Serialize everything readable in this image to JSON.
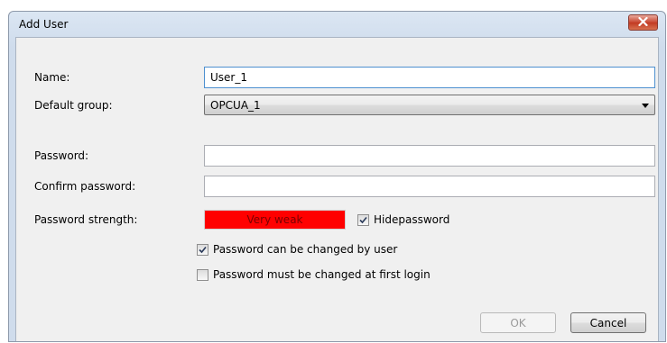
{
  "window": {
    "title": "Add User",
    "close_icon": "close-icon"
  },
  "form": {
    "name_label": "Name:",
    "name_value": "User_1",
    "default_group_label": "Default group:",
    "default_group_value": "OPCUA_1",
    "password_label": "Password:",
    "password_value": "",
    "confirm_password_label": "Confirm password:",
    "confirm_password_value": "",
    "password_strength_label": "Password strength:",
    "password_strength_value": "Very weak",
    "password_strength_color": "#ff0000",
    "hide_password_label": "Hidepassword",
    "hide_password_checked": true,
    "can_be_changed_label": "Password can be changed by user",
    "can_be_changed_checked": true,
    "must_change_label": "Password must be changed at first login",
    "must_change_checked": false
  },
  "buttons": {
    "ok_label": "OK",
    "ok_enabled": false,
    "cancel_label": "Cancel"
  }
}
